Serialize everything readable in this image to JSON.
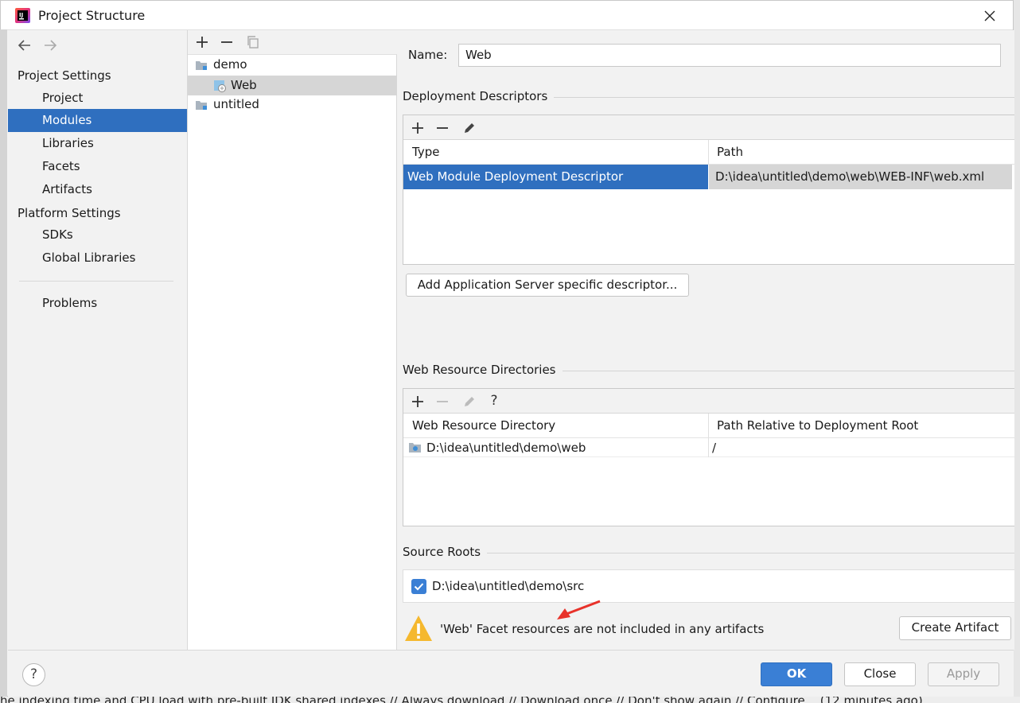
{
  "window": {
    "title": "Project Structure"
  },
  "background_hint": "he indexing time and CPU load with pre-built JDK shared indexes // Always download // Download once // Don't show again // Configure... (12 minutes ago)",
  "nav": {
    "project_settings": "Project Settings",
    "project_items": [
      "Project",
      "Modules",
      "Libraries",
      "Facets",
      "Artifacts"
    ],
    "platform_settings": "Platform Settings",
    "platform_items": [
      "SDKs",
      "Global Libraries"
    ],
    "problems": "Problems",
    "selected": "Modules"
  },
  "tree": {
    "items": [
      {
        "label": "demo"
      },
      {
        "label": "Web"
      },
      {
        "label": "untitled"
      }
    ]
  },
  "form": {
    "name_label": "Name:",
    "name_value": "Web",
    "deployment_descriptors": {
      "title": "Deployment Descriptors",
      "columns": [
        "Type",
        "Path"
      ],
      "rows": [
        {
          "type": "Web Module Deployment Descriptor",
          "path": "D:\\idea\\untitled\\demo\\web\\WEB-INF\\web.xml"
        }
      ],
      "add_button": "Add Application Server specific descriptor..."
    },
    "web_resource_directories": {
      "title": "Web Resource Directories",
      "columns": [
        "Web Resource Directory",
        "Path Relative to Deployment Root"
      ],
      "rows": [
        {
          "directory": "D:\\idea\\untitled\\demo\\web",
          "relative": "/"
        }
      ],
      "help_glyph": "?"
    },
    "source_roots": {
      "title": "Source Roots",
      "item": "D:\\idea\\untitled\\demo\\src",
      "checked": true
    },
    "warning": {
      "text": "'Web' Facet resources are not included in any artifacts",
      "button": "Create Artifact"
    }
  },
  "footer": {
    "help": "?",
    "ok": "OK",
    "close": "Close",
    "apply": "Apply"
  },
  "colors": {
    "selection": "#2f6fbf",
    "primary_button": "#3a7fd5",
    "warning": "#f5b82e",
    "annotation_arrow": "#e8322a"
  }
}
